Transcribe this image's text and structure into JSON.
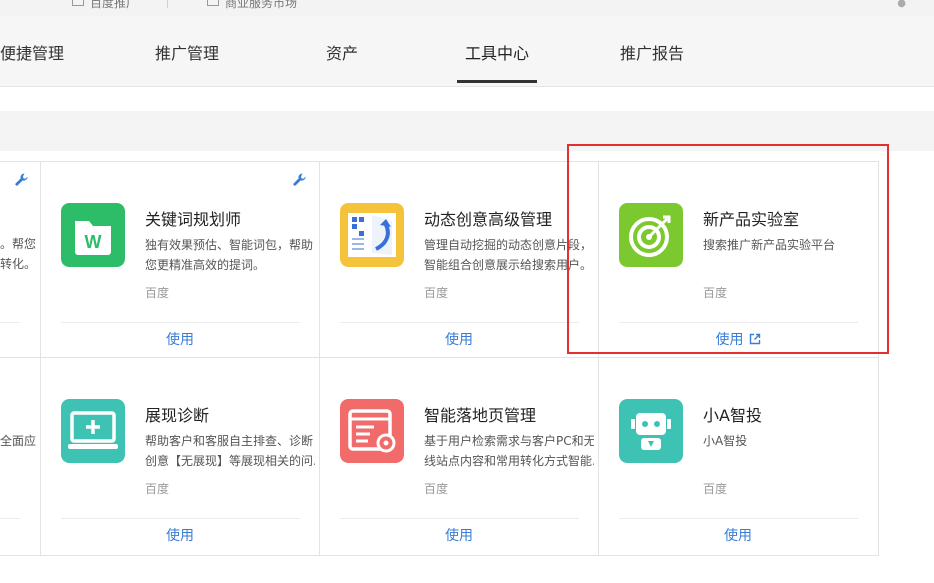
{
  "topbar": {
    "item_left": "百度推广",
    "item_right": "商业服务市场"
  },
  "nav": {
    "tabs": [
      {
        "label": "便捷管理"
      },
      {
        "label": "推广管理"
      },
      {
        "label": "资产"
      },
      {
        "label": "工具中心",
        "active": true
      },
      {
        "label": "推广报告"
      }
    ]
  },
  "partial_column": {
    "row1_lines": [
      "。帮您",
      "转化。"
    ],
    "row2_lines": [
      "全面应"
    ]
  },
  "cards": [
    {
      "title": "关键词规划师",
      "desc_lines": [
        "独有效果预估、智能词包，帮助",
        "您更精准高效的提词。"
      ],
      "vendor": "百度",
      "action": "使用",
      "icon": "folder-w-icon",
      "color": "#2dbd68"
    },
    {
      "title": "动态创意高级管理",
      "desc_lines": [
        "管理自动挖掘的动态创意片段，",
        "智能组合创意展示给搜索用户。"
      ],
      "vendor": "百度",
      "action": "使用",
      "icon": "book-arrow-icon",
      "color": "#f5c33b"
    },
    {
      "title": "新产品实验室",
      "desc_lines": [
        "搜索推广新产品实验平台"
      ],
      "vendor": "百度",
      "action": "使用",
      "icon": "target-icon",
      "color": "#7bc92f",
      "external": true
    },
    {
      "title": "展现诊断",
      "desc_lines": [
        "帮助客户和客服自主排查、诊断",
        "创意【无展现】等展现相关的问..."
      ],
      "vendor": "百度",
      "action": "使用",
      "icon": "monitor-plus-icon",
      "color": "#3ec2b4"
    },
    {
      "title": "智能落地页管理",
      "desc_lines": [
        "基于用户检索需求与客户PC和无",
        "线站点内容和常用转化方式智能..."
      ],
      "vendor": "百度",
      "action": "使用",
      "icon": "page-gear-icon",
      "color": "#f26b6b"
    },
    {
      "title": "小A智投",
      "desc_lines": [
        "小A智投"
      ],
      "vendor": "百度",
      "action": "使用",
      "icon": "robot-icon",
      "color": "#3ec2b4"
    }
  ]
}
